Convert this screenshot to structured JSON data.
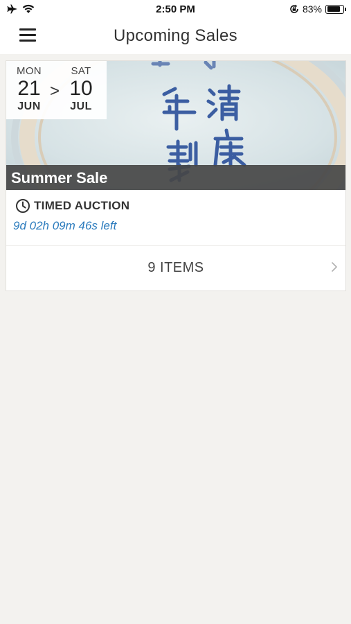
{
  "status_bar": {
    "time": "2:50 PM",
    "battery_percent": "83%",
    "battery_level": 0.83,
    "icons": [
      "airplane-icon",
      "wifi-icon",
      "orientation-lock-icon",
      "battery-icon"
    ]
  },
  "nav": {
    "title": "Upcoming Sales",
    "menu_icon": "hamburger-menu-icon"
  },
  "sale": {
    "start": {
      "day": "MON",
      "date": "21",
      "month": "JUN"
    },
    "separator": ">",
    "end": {
      "day": "SAT",
      "date": "10",
      "month": "JUL"
    },
    "title": "Summer Sale",
    "auction_type": "TIMED AUCTION",
    "auction_icon": "clock-icon",
    "time_left": "9d 02h 09m 46s left",
    "items_label": "9 ITEMS",
    "chevron_icon": "chevron-right-icon"
  },
  "colors": {
    "background": "#f3f2ef",
    "time_left": "#2b7bbd",
    "title_bar": "#464646",
    "porcelain_blue": "#2a4f9a"
  }
}
